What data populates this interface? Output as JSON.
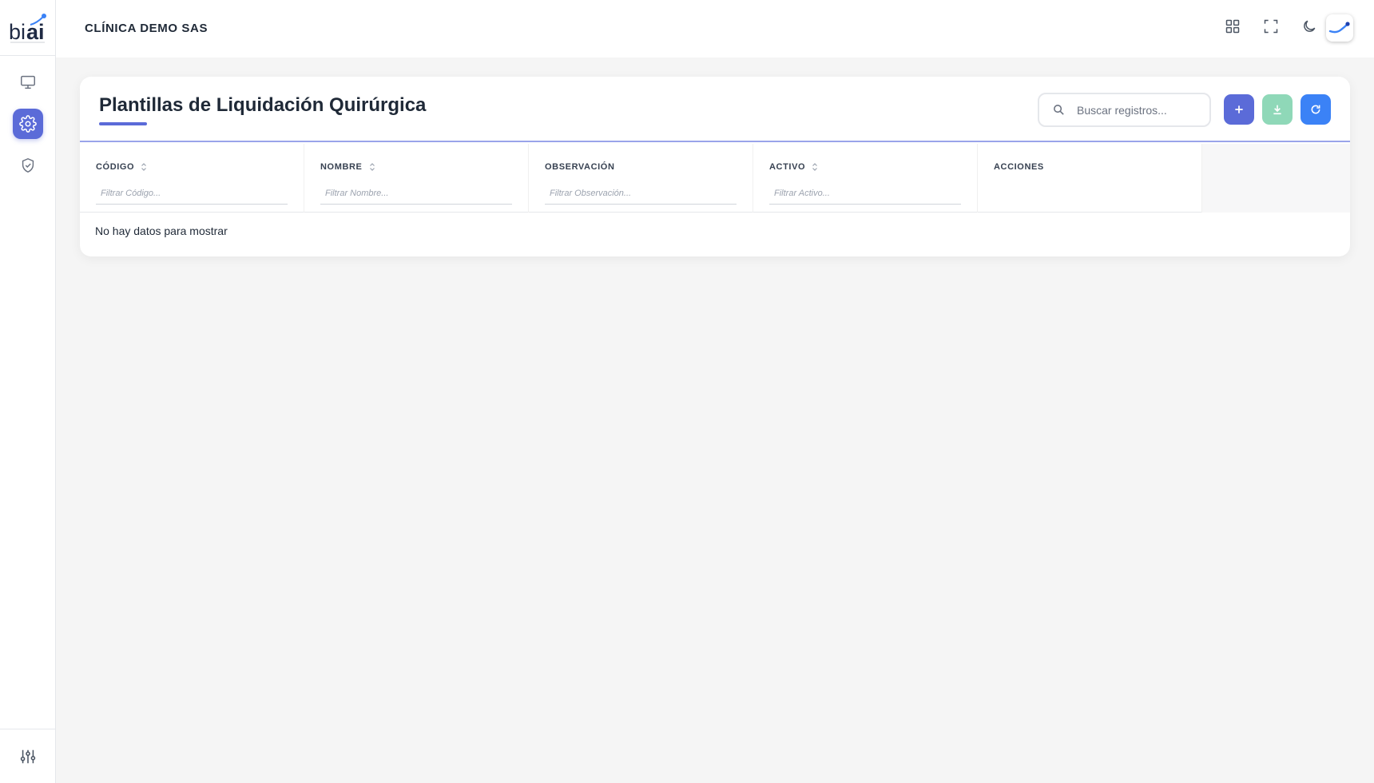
{
  "sidebar": {
    "logo_text": "biai",
    "items": [
      {
        "name": "monitor",
        "icon": "monitor-icon",
        "active": false
      },
      {
        "name": "settings",
        "icon": "gear-icon",
        "active": true
      },
      {
        "name": "security",
        "icon": "shield-check-icon",
        "active": false
      }
    ],
    "footer_icon": "sliders-icon"
  },
  "topbar": {
    "company": "CLÍNICA DEMO SAS",
    "icons": [
      "grid-icon",
      "fullscreen-icon",
      "moon-icon"
    ],
    "avatar_icon": "brand-swoosh-icon"
  },
  "page": {
    "title": "Plantillas de Liquidación Quirúrgica",
    "search_placeholder": "Buscar registros...",
    "actions": {
      "add_icon": "plus-icon",
      "download_icon": "download-icon",
      "refresh_icon": "refresh-icon"
    }
  },
  "table": {
    "columns": [
      {
        "label": "CÓDIGO",
        "sortable": true,
        "filter_placeholder": "Filtrar Código..."
      },
      {
        "label": "NOMBRE",
        "sortable": true,
        "filter_placeholder": "Filtrar Nombre..."
      },
      {
        "label": "OBSERVACIÓN",
        "sortable": false,
        "filter_placeholder": "Filtrar Observación..."
      },
      {
        "label": "ACTIVO",
        "sortable": true,
        "filter_placeholder": "Filtrar Activo..."
      },
      {
        "label": "ACCIONES",
        "sortable": false,
        "filter_placeholder": ""
      }
    ],
    "empty_message": "No hay datos para mostrar"
  },
  "colors": {
    "primary": "#5b6bd8",
    "success_light": "#8fd8b8",
    "info": "#3b82f6",
    "background": "#f5f5f5"
  }
}
